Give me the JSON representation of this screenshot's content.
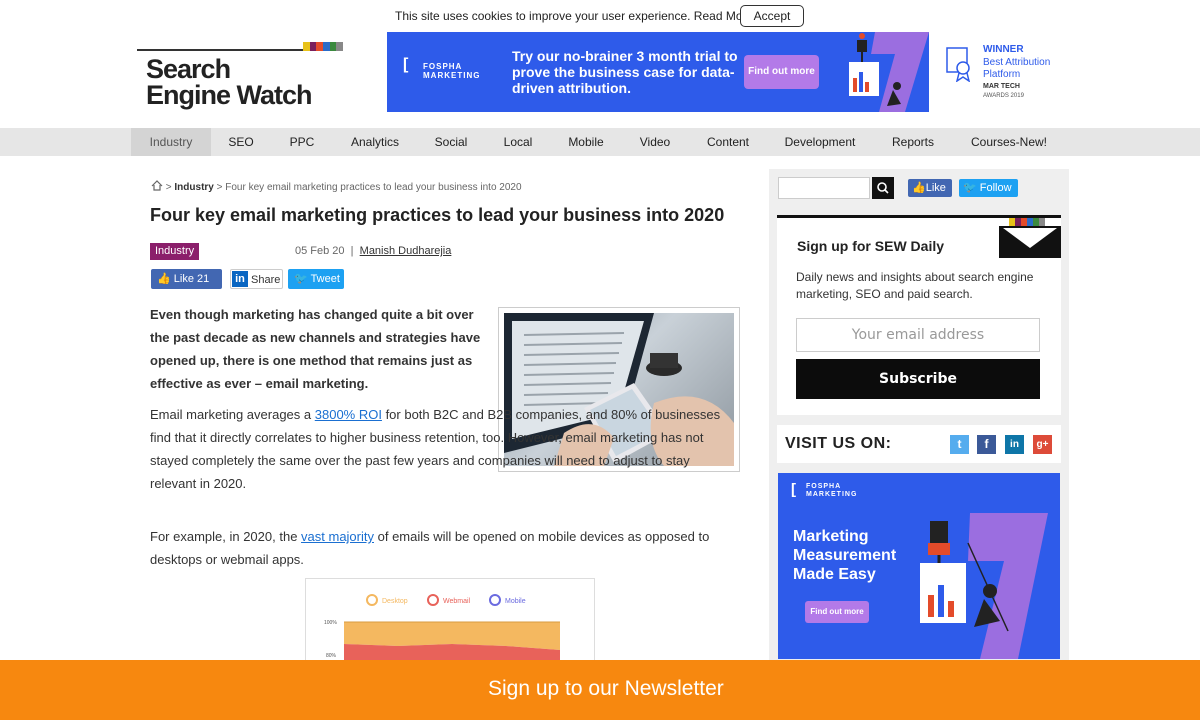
{
  "cookie": {
    "text": "This site uses cookies to improve your user experience. Read More",
    "accept_label": "Accept"
  },
  "logo": {
    "line1": "Search",
    "line2": "Engine Watch",
    "stripe_colors": [
      "#e8c21a",
      "#7a1f5c",
      "#e34b2a",
      "#2a6cc9",
      "#3b8a3e",
      "#888888"
    ]
  },
  "banner": {
    "brand": "FOSPHA MARKETING",
    "headline": "Try our no-brainer 3 month trial to prove the business case for data-driven attribution.",
    "cta": "Find out more",
    "bg_color": "#2e5bea"
  },
  "award": {
    "title": "WINNER",
    "subtitle": "Best Attribution Platform",
    "org": "MAR TECH",
    "year": "AWARDS 2019"
  },
  "nav": {
    "items": [
      "Industry",
      "SEO",
      "PPC",
      "Analytics",
      "Social",
      "Local",
      "Mobile",
      "Video",
      "Content",
      "Development",
      "Reports",
      "Courses-New!"
    ]
  },
  "breadcrumb": {
    "separator1": ">",
    "level1": "Industry",
    "separator2": ">",
    "current": "Four key email marketing practices to lead your business into 2020"
  },
  "article": {
    "title": "Four key email marketing practices to lead your business into 2020",
    "tag": "Industry",
    "date": "05 Feb 20",
    "sep": "|",
    "author": "Manish Dudharejia",
    "like_label": "Like 21",
    "share_label": "Share",
    "tweet_label": "Tweet",
    "lead": "Even though marketing has changed quite a bit over the past decade as new channels and strategies have opened up, there is one method that remains just as effective as ever – email marketing.",
    "p1_before": "Email marketing averages a ",
    "p1_link": "3800% ROI",
    "p1_after": " for both B2C and B2B companies, and 80% of businesses find that it directly correlates to higher business retention, too. However, email marketing has not stayed completely the same over the past few years and companies will need to adjust to stay relevant in 2020.",
    "p2_before": "For example, in 2020, the ",
    "p2_link": "vast majority",
    "p2_after": " of emails will be opened on mobile devices as opposed to desktops or webmail apps."
  },
  "embedded_chart": {
    "legend": [
      "Desktop",
      "Webmail",
      "Mobile"
    ],
    "yticks": [
      "100%",
      "80%"
    ],
    "series_colors": [
      "#f4b860",
      "#e8625a",
      "#6b6be0"
    ]
  },
  "sidebar": {
    "search_placeholder": "",
    "fb_label": "Like",
    "tw_label": "Follow",
    "signup_title": "Sign up for SEW Daily",
    "signup_desc": "Daily news and insights about search engine marketing, SEO and paid search.",
    "email_placeholder": "Your email address",
    "subscribe_label": "Subscribe",
    "visit_label": "VISIT US ON:",
    "social": [
      {
        "icon": "twitter-icon",
        "glyph": "t",
        "color": "#55acee"
      },
      {
        "icon": "facebook-icon",
        "glyph": "f",
        "color": "#3b5998"
      },
      {
        "icon": "linkedin-icon",
        "glyph": "in",
        "color": "#0e76a8"
      },
      {
        "icon": "googleplus-icon",
        "glyph": "g+",
        "color": "#dd4b39"
      }
    ]
  },
  "ad2": {
    "brand": "FOSPHA MARKETING",
    "headline": "Marketing Measurement Made Easy",
    "cta": "Find out more"
  },
  "newsletter": {
    "text": "Sign up to our Newsletter"
  }
}
